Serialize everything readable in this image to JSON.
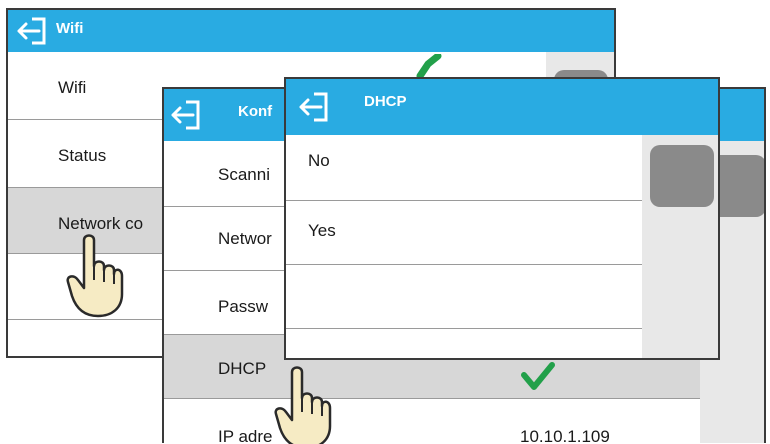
{
  "wifi_window": {
    "title": "Wifi",
    "items": [
      {
        "label": "Wifi"
      },
      {
        "label": "Status"
      },
      {
        "label": "Network co"
      },
      {
        "label": ""
      },
      {
        "label": ""
      }
    ]
  },
  "config_window": {
    "title": "Konf",
    "items": [
      {
        "label": "Scanni"
      },
      {
        "label": "Networ"
      },
      {
        "label": "Passw"
      },
      {
        "label": "DHCP"
      },
      {
        "label": "IP adre"
      }
    ],
    "ip_value": "10.10.1.109"
  },
  "dhcp_window": {
    "title": "DHCP",
    "options": [
      {
        "label": "No"
      },
      {
        "label": "Yes"
      },
      {
        "label": ""
      },
      {
        "label": ""
      }
    ]
  },
  "colors": {
    "titlebar": "#29abe2",
    "selected_row": "#d7d7d7",
    "check": "#22a04a",
    "scroll_thumb": "#8a8a8a"
  },
  "icons": [
    "back-arrow-icon",
    "check-icon",
    "pointing-hand-icon"
  ]
}
